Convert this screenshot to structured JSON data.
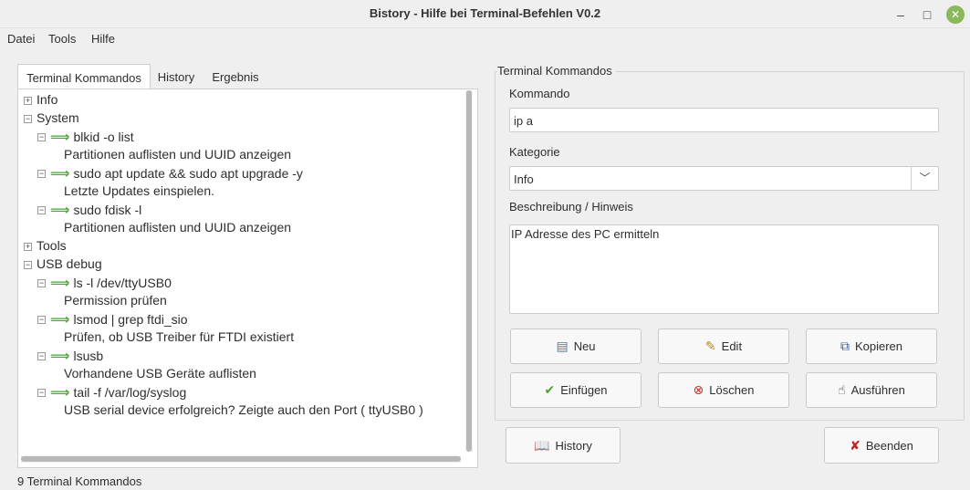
{
  "window": {
    "title": "Bistory - Hilfe bei Terminal-Befehlen  V0.2",
    "min_glyph": "–",
    "max_glyph": "□",
    "close_glyph": "✕"
  },
  "menu": [
    "Datei",
    "Tools",
    "Hilfe"
  ],
  "tabs": [
    "Terminal Kommandos",
    "History",
    "Ergebnis"
  ],
  "tree": [
    {
      "text": "Info",
      "level": 0,
      "expander": "+",
      "arrow": false
    },
    {
      "text": "System",
      "level": 0,
      "expander": "−",
      "arrow": false
    },
    {
      "text": "blkid -o list",
      "level": 1,
      "expander": "−",
      "arrow": true
    },
    {
      "text": "Partitionen auflisten und UUID anzeigen",
      "level": 2,
      "expander": "",
      "arrow": false
    },
    {
      "text": "sudo apt update && sudo apt upgrade -y",
      "level": 1,
      "expander": "−",
      "arrow": true
    },
    {
      "text": "Letzte Updates einspielen.",
      "level": 2,
      "expander": "",
      "arrow": false
    },
    {
      "text": "sudo fdisk -l",
      "level": 1,
      "expander": "−",
      "arrow": true
    },
    {
      "text": "Partitionen auflisten und UUID anzeigen",
      "level": 2,
      "expander": "",
      "arrow": false
    },
    {
      "text": "Tools",
      "level": 0,
      "expander": "+",
      "arrow": false
    },
    {
      "text": "USB debug",
      "level": 0,
      "expander": "−",
      "arrow": false
    },
    {
      "text": "ls -l /dev/ttyUSB0",
      "level": 1,
      "expander": "−",
      "arrow": true
    },
    {
      "text": "Permission prüfen",
      "level": 2,
      "expander": "",
      "arrow": false
    },
    {
      "text": "lsmod | grep ftdi_sio",
      "level": 1,
      "expander": "−",
      "arrow": true
    },
    {
      "text": "Prüfen, ob USB Treiber für FTDI existiert",
      "level": 2,
      "expander": "",
      "arrow": false
    },
    {
      "text": "lsusb",
      "level": 1,
      "expander": "−",
      "arrow": true
    },
    {
      "text": "Vorhandene USB Geräte auflisten",
      "level": 2,
      "expander": "",
      "arrow": false
    },
    {
      "text": "tail -f /var/log/syslog",
      "level": 1,
      "expander": "−",
      "arrow": true
    },
    {
      "text": "USB serial device erfolgreich? Zeigte auch den Port ( ttyUSB0 )",
      "level": 2,
      "expander": "",
      "arrow": false
    }
  ],
  "status": "9 Terminal Kommandos",
  "form": {
    "group_title": "Terminal Kommandos",
    "kommando_label": "Kommando",
    "kommando_value": "ip a",
    "kategorie_label": "Kategorie",
    "kategorie_value": "Info",
    "beschreibung_label": "Beschreibung / Hinweis",
    "beschreibung_value": "IP Adresse des PC ermitteln"
  },
  "buttons": {
    "neu": "Neu",
    "edit": "Edit",
    "kopieren": "Kopieren",
    "einfuegen": "Einfügen",
    "loeschen": "Löschen",
    "ausfuehren": "Ausführen",
    "history": "History",
    "beenden": "Beenden"
  },
  "colors": {
    "arrow": "#4aa534",
    "close_button": "#8ab85a",
    "delete_icon": "#d32a2a",
    "quit_icon": "#c62020"
  },
  "icons": {
    "neu": "window-icon",
    "edit": "edit-icon",
    "kopieren": "copy-icon",
    "einfuegen": "checkmark-icon",
    "loeschen": "delete-icon",
    "ausfuehren": "run-icon",
    "history": "book-icon",
    "beenden": "quit-icon"
  }
}
